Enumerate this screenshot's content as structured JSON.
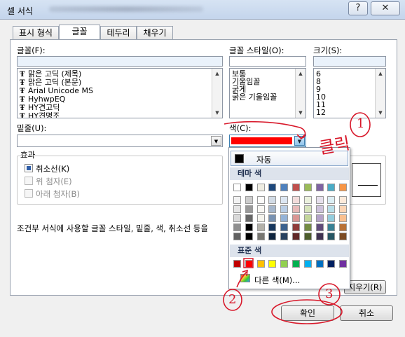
{
  "window": {
    "title": "셀 서식",
    "help_label": "?",
    "close_label": "✕"
  },
  "tabs": [
    "표시 형식",
    "글꼴",
    "테두리",
    "채우기"
  ],
  "font": {
    "label": "글꼴(F):",
    "items": [
      "맑은 고딕 (제목)",
      "맑은 고딕 (본문)",
      "Arial Unicode MS",
      "HyhwpEQ",
      "HY견고딕",
      "HY견명조"
    ]
  },
  "style": {
    "label": "글꼴 스타일(O):",
    "items": [
      "보통",
      "기울임꼴",
      "굵게",
      "굵은 기울임꼴"
    ]
  },
  "size": {
    "label": "크기(S):",
    "items": [
      "6",
      "8",
      "9",
      "10",
      "11",
      "12"
    ]
  },
  "underline": {
    "label": "밑줄(U):"
  },
  "color": {
    "label": "색(C):",
    "swatch": "#ff0000"
  },
  "effects": {
    "label": "효과",
    "strike": "취소선(K)",
    "superscript": "위 첨자(E)",
    "subscript": "아래 첨자(B)"
  },
  "note": "조건부 서식에 사용할 글꼴 스타일, 밑줄, 색, 취소선 등을",
  "popup": {
    "auto_label": "자동",
    "theme_label": "테마 색",
    "standard_label": "표준 색",
    "more_label": "다른 색(M)...",
    "theme_top": [
      "#ffffff",
      "#000000",
      "#eeece1",
      "#1f497d",
      "#4f81bd",
      "#c0504d",
      "#9bbb59",
      "#8064a2",
      "#4bacc6",
      "#f79646"
    ],
    "standard": [
      "#c00000",
      "#ff0000",
      "#ffc000",
      "#ffff00",
      "#92d050",
      "#00b050",
      "#00b0f0",
      "#0070c0",
      "#002060",
      "#7030a0"
    ]
  },
  "buttons": {
    "clear": "지우기(R)",
    "ok": "확인",
    "cancel": "취소"
  },
  "annotations": {
    "click_text": "클릭",
    "n1": "1",
    "n2": "2",
    "n3": "3"
  }
}
